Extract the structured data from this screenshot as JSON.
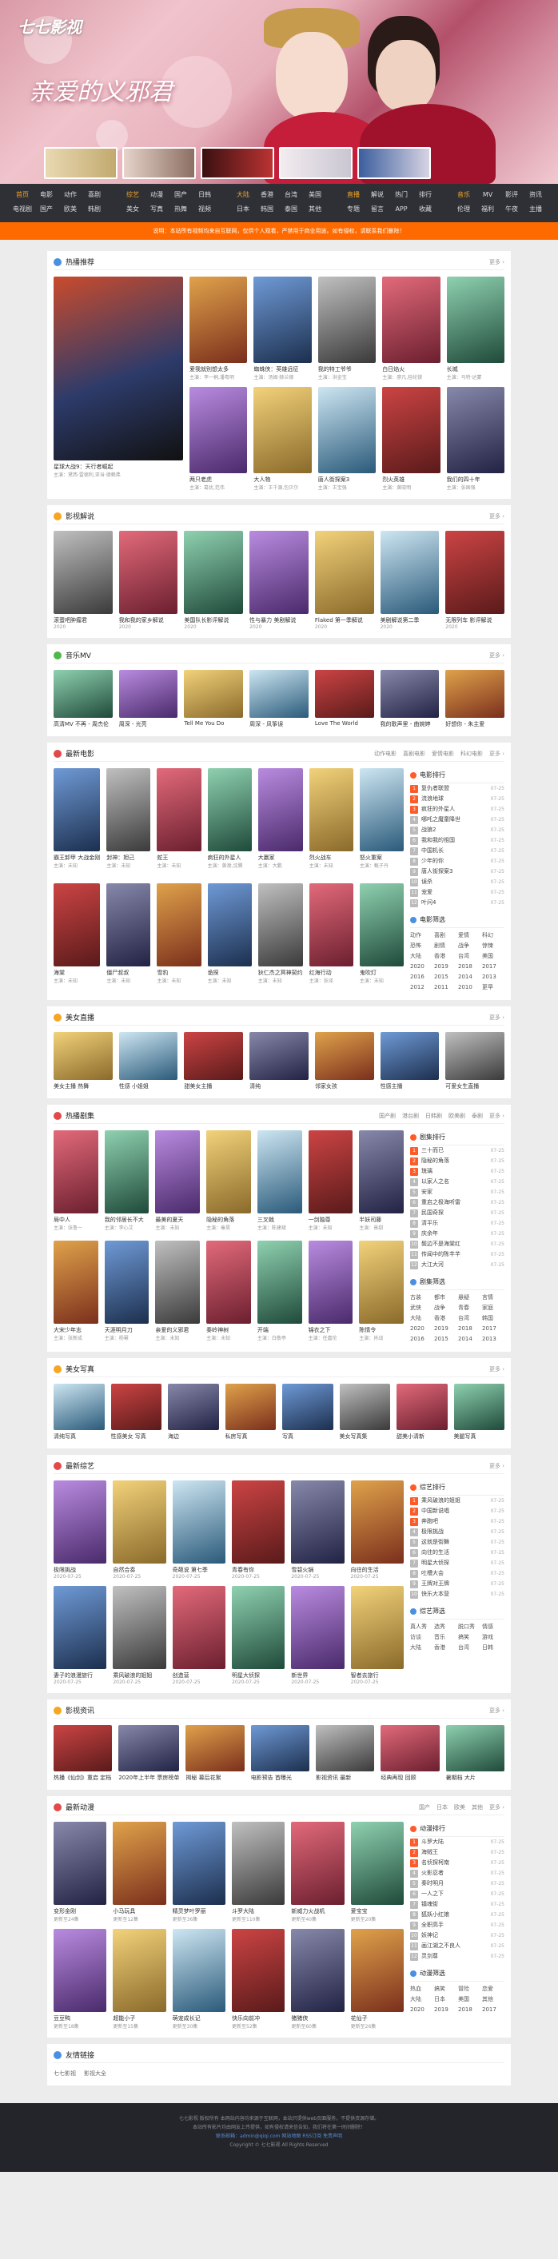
{
  "header": {
    "logo": "七七影视",
    "hero_title": "亲爱的义邪君"
  },
  "nav": [
    [
      "首页",
      "电影",
      "动作",
      "喜剧",
      "电视剧",
      "国产",
      "欧美",
      "韩剧"
    ],
    [
      "综艺",
      "动漫",
      "国产",
      "日韩",
      "美女",
      "写真",
      "热舞",
      "视频"
    ],
    [
      "大陆",
      "香港",
      "台湾",
      "美国",
      "日本",
      "韩国",
      "泰国",
      "其他"
    ],
    [
      "直播",
      "解说",
      "热门",
      "排行",
      "专题",
      "留言",
      "APP",
      "收藏"
    ],
    [
      "音乐",
      "MV",
      "影评",
      "资讯",
      "伦理",
      "福利",
      "午夜",
      "主播"
    ]
  ],
  "notice": "说明：本站所有视频均来自互联网，仅供个人观看，严禁用于商业用途。如有侵权，请联系我们删除！",
  "sec_hot": {
    "title": "热播推荐",
    "more": "更多 ›",
    "feature": {
      "name": "星球大战9：天行者崛起",
      "sub": "主演：黛西·雷德利,亚当·德赖弗"
    },
    "items": [
      {
        "n": "爱我就别想太多",
        "s": "主演：李一桐,潘粤明"
      },
      {
        "n": "蜘蛛侠：英雄远征",
        "s": "主演：汤姆·赫兰德"
      },
      {
        "n": "我的特工爷爷",
        "s": "主演：洪金宝"
      },
      {
        "n": "白日焰火",
        "s": "主演：廖凡,桂纶镁"
      },
      {
        "n": "长城",
        "s": "主演：马特·达蒙"
      },
      {
        "n": "两只老虎",
        "s": "主演：葛优,范伟"
      },
      {
        "n": "大人物",
        "s": "主演：王千源,包贝尔"
      },
      {
        "n": "唐人街探案3",
        "s": "主演：王宝强"
      },
      {
        "n": "烈火英雄",
        "s": "主演：黄晓明"
      },
      {
        "n": "我们的四十年",
        "s": "主演：张国强"
      }
    ]
  },
  "sec_commentary": {
    "title": "影视解说",
    "more": "更多 ›",
    "items": [
      {
        "n": "滚蛋吧肿瘤君",
        "d": "2020"
      },
      {
        "n": "我和我的家乡解说",
        "d": "2020"
      },
      {
        "n": "美国队长影评解说",
        "d": "2020"
      },
      {
        "n": "性与暴力 美剧解说",
        "d": "2020"
      },
      {
        "n": "Flaked 第一季解说",
        "d": "2020"
      },
      {
        "n": "美剧解说第二季",
        "d": "2020"
      },
      {
        "n": "无限列车 影评解说",
        "d": "2020"
      }
    ]
  },
  "sec_music": {
    "title": "音乐MV",
    "more": "更多 ›",
    "items": [
      "高清MV 不再 - 周杰伦",
      "周深 - 光亮",
      "Tell Me You Do",
      "周深 - 风筝误",
      "Love The World",
      "我的歌声里 - 曲婉婷",
      "好想你 - 朱主爱"
    ]
  },
  "sec_movie": {
    "title": "最新电影",
    "tabs": [
      "动作电影",
      "喜剧电影",
      "爱情电影",
      "科幻电影"
    ],
    "more": "更多 ›",
    "items": [
      {
        "n": "霸王卸甲 大战金刚",
        "s": "主演：未知"
      },
      {
        "n": "封神：妲己",
        "s": "主演：未知"
      },
      {
        "n": "蛇王",
        "s": "主演：未知"
      },
      {
        "n": "疯狂的外星人",
        "s": "主演：黄渤,沈腾"
      },
      {
        "n": "大赢家",
        "s": "主演：大鹏"
      },
      {
        "n": "烈火战车",
        "s": "主演：未知"
      },
      {
        "n": "怒火重案",
        "s": "主演：甄子丹"
      },
      {
        "n": "海棠",
        "s": "主演：未知"
      },
      {
        "n": "僵尸叔叔",
        "s": "主演：未知"
      },
      {
        "n": "雪豹",
        "s": "主演：未知"
      },
      {
        "n": "诡探",
        "s": "主演：未知"
      },
      {
        "n": "狄仁杰之冥神契约",
        "s": "主演：未知"
      },
      {
        "n": "红海行动",
        "s": "主演：张译"
      },
      {
        "n": "鬼吹灯",
        "s": "主演：未知"
      }
    ],
    "rank_title": "电影排行",
    "rank": [
      "复仇者联盟",
      "流浪地球",
      "疯狂的外星人",
      "哪吒之魔童降世",
      "战狼2",
      "我和我的祖国",
      "中国机长",
      "少年的你",
      "唐人街探案3",
      "误杀",
      "宠爱",
      "叶问4"
    ],
    "rank_date": "07-25",
    "filter_title": "电影筛选",
    "filter": [
      "动作",
      "喜剧",
      "爱情",
      "科幻",
      "恐怖",
      "剧情",
      "战争",
      "惊悚",
      "大陆",
      "香港",
      "台湾",
      "美国",
      "2020",
      "2019",
      "2018",
      "2017",
      "2016",
      "2015",
      "2014",
      "2013",
      "2012",
      "2011",
      "2010",
      "更早"
    ]
  },
  "sec_beauty": {
    "title": "美女直播",
    "more": "更多 ›",
    "items": [
      "美女主播 热舞",
      "性感 小姐姐",
      "甜美女主播",
      "清纯",
      "邻家女孩",
      "性感主播",
      "可爱女生直播"
    ]
  },
  "sec_tv": {
    "title": "热播剧集",
    "tabs": [
      "国产剧",
      "港台剧",
      "日韩剧",
      "欧美剧",
      "泰剧"
    ],
    "more": "更多 ›",
    "items": [
      {
        "n": "局中人",
        "s": "主演：张鲁一"
      },
      {
        "n": "我的邻居长不大",
        "s": "主演：李心艾"
      },
      {
        "n": "最美的夏天",
        "s": "主演：未知"
      },
      {
        "n": "隐秘的角落",
        "s": "主演：秦昊"
      },
      {
        "n": "三叉戟",
        "s": "主演：陈建斌"
      },
      {
        "n": "一剑独尊",
        "s": "主演：未知"
      },
      {
        "n": "半妖司藤",
        "s": "主演：景甜"
      },
      {
        "n": "大宋少年志",
        "s": "主演：张新成"
      },
      {
        "n": "天涯明月刀",
        "s": "主演：杨幂"
      },
      {
        "n": "亲爱的义邪君",
        "s": "主演：未知"
      },
      {
        "n": "秦岭神树",
        "s": "主演：未知"
      },
      {
        "n": "开端",
        "s": "主演：白敬亭"
      },
      {
        "n": "锦衣之下",
        "s": "主演：任嘉伦"
      },
      {
        "n": "陈情令",
        "s": "主演：肖战"
      }
    ],
    "rank_title": "剧集排行",
    "rank": [
      "三十而已",
      "隐秘的角落",
      "琉璃",
      "以家人之名",
      "安家",
      "重启之极海听雷",
      "民国奇探",
      "清平乐",
      "庆余年",
      "鬓边不是海棠红",
      "传闻中的陈芊芊",
      "大江大河"
    ],
    "rank_date": "07-25",
    "filter_title": "剧集筛选",
    "filter": [
      "古装",
      "都市",
      "悬疑",
      "言情",
      "武侠",
      "战争",
      "青春",
      "家庭",
      "大陆",
      "香港",
      "台湾",
      "韩国",
      "2020",
      "2019",
      "2018",
      "2017",
      "2016",
      "2015",
      "2014",
      "2013"
    ]
  },
  "sec_photo": {
    "title": "美女写真",
    "more": "更多 ›",
    "items": [
      "清纯写真",
      "性感美女 写真",
      "海边",
      "私房写真",
      "写真",
      "美女写真集",
      "甜美小清新",
      "美腿写真"
    ]
  },
  "sec_variety": {
    "title": "最新综艺",
    "more": "更多 ›",
    "items": [
      {
        "n": "极限挑战",
        "s": "2020-07-25"
      },
      {
        "n": "自然合奏",
        "s": "2020-07-25"
      },
      {
        "n": "奇葩说 第七季",
        "s": "2020-07-25"
      },
      {
        "n": "青春有你",
        "s": "2020-07-25"
      },
      {
        "n": "雪碧火锅",
        "s": "2020-07-25"
      },
      {
        "n": "向往的生活",
        "s": "2020-07-25"
      },
      {
        "n": "妻子的浪漫旅行",
        "s": "2020-07-25"
      },
      {
        "n": "乘风破浪的姐姐",
        "s": "2020-07-25"
      },
      {
        "n": "创造营",
        "s": "2020-07-25"
      },
      {
        "n": "明星大侦探",
        "s": "2020-07-25"
      },
      {
        "n": "新世界",
        "s": "2020-07-25"
      },
      {
        "n": "智者去旅行",
        "s": "2020-07-25"
      }
    ],
    "rank_title": "综艺排行",
    "rank": [
      "乘风破浪的姐姐",
      "中国新说唱",
      "奔跑吧",
      "极限挑战",
      "这就是街舞",
      "向往的生活",
      "明星大侦探",
      "吐槽大会",
      "王牌对王牌",
      "快乐大本营"
    ],
    "rank_date": "07-25",
    "filter_title": "综艺筛选",
    "filter": [
      "真人秀",
      "选秀",
      "脱口秀",
      "情感",
      "访谈",
      "音乐",
      "搞笑",
      "游戏",
      "大陆",
      "香港",
      "台湾",
      "日韩"
    ]
  },
  "sec_film_review": {
    "title": "影视资讯",
    "more": "更多 ›",
    "items": [
      "热播《仙剑》重启 定档",
      "2020年上半年 票房榜单",
      "揭秘 幕后花絮",
      "电影预告 首曝光",
      "影视资讯 最新",
      "经典再现 回顾",
      "暑期档 大片"
    ]
  },
  "sec_anime": {
    "title": "最新动漫",
    "tabs": [
      "国产",
      "日本",
      "欧美",
      "其他"
    ],
    "more": "更多 ›",
    "items": [
      {
        "n": "变形金刚",
        "s": "更新至24集"
      },
      {
        "n": "小马玩具",
        "s": "更新至12集"
      },
      {
        "n": "精灵梦叶罗丽",
        "s": "更新至36集"
      },
      {
        "n": "斗罗大陆",
        "s": "更新至110集"
      },
      {
        "n": "新威力火战机",
        "s": "更新至40集"
      },
      {
        "n": "爱宝宝",
        "s": "更新至20集"
      },
      {
        "n": "豆豆鸭",
        "s": "更新至18集"
      },
      {
        "n": "超能小子",
        "s": "更新至15集"
      },
      {
        "n": "萌宠成长记",
        "s": "更新至30集"
      },
      {
        "n": "快乐向前冲",
        "s": "更新至52集"
      },
      {
        "n": "猪猪侠",
        "s": "更新至60集"
      },
      {
        "n": "花仙子",
        "s": "更新至26集"
      }
    ],
    "rank_title": "动漫排行",
    "rank": [
      "斗罗大陆",
      "海贼王",
      "名侦探柯南",
      "火影忍者",
      "秦时明月",
      "一人之下",
      "镇魂街",
      "狐妖小红娘",
      "全职高手",
      "妖神记",
      "画江湖之不良人",
      "灵剑尊"
    ],
    "rank_date": "07-25",
    "filter_title": "动漫筛选",
    "filter": [
      "热血",
      "搞笑",
      "冒险",
      "恋爱",
      "大陆",
      "日本",
      "美国",
      "其他",
      "2020",
      "2019",
      "2018",
      "2017"
    ]
  },
  "links": {
    "title": "友情链接",
    "items": [
      "七七影视",
      "影视大全"
    ]
  },
  "footer": {
    "l1": "七七影视 版权所有 本网站内容均来源于互联网，本站只提供web页面服务，不提供资源存储。",
    "l2": "本站所有影片均由网友上传提供，如有侵权请来信告知，我们将在第一时间删除！",
    "l3": "联系邮箱：admin@qiqi.com  网站地图  RSS订阅  免责声明",
    "l4": "Copyright © 七七影视 All Rights Reserved"
  }
}
